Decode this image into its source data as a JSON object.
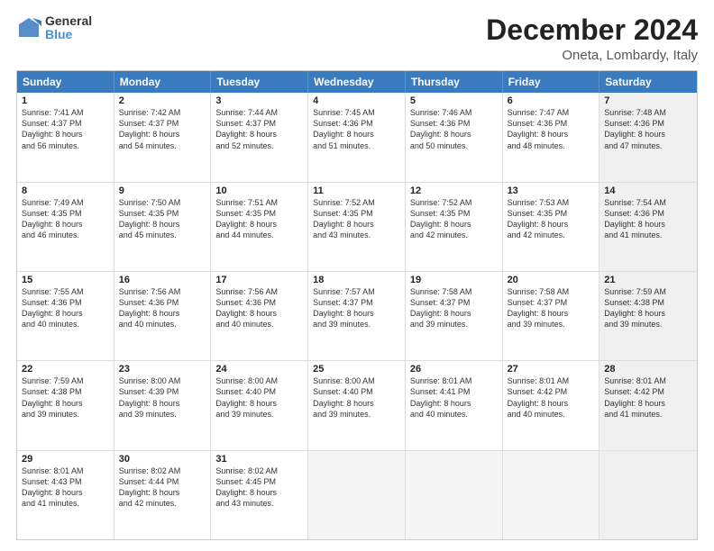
{
  "header": {
    "logo_line1": "General",
    "logo_line2": "Blue",
    "month_title": "December 2024",
    "location": "Oneta, Lombardy, Italy"
  },
  "days_of_week": [
    "Sunday",
    "Monday",
    "Tuesday",
    "Wednesday",
    "Thursday",
    "Friday",
    "Saturday"
  ],
  "weeks": [
    [
      {
        "day": "1",
        "info": "Sunrise: 7:41 AM\nSunset: 4:37 PM\nDaylight: 8 hours\nand 56 minutes.",
        "empty": false,
        "shaded": false
      },
      {
        "day": "2",
        "info": "Sunrise: 7:42 AM\nSunset: 4:37 PM\nDaylight: 8 hours\nand 54 minutes.",
        "empty": false,
        "shaded": false
      },
      {
        "day": "3",
        "info": "Sunrise: 7:44 AM\nSunset: 4:37 PM\nDaylight: 8 hours\nand 52 minutes.",
        "empty": false,
        "shaded": false
      },
      {
        "day": "4",
        "info": "Sunrise: 7:45 AM\nSunset: 4:36 PM\nDaylight: 8 hours\nand 51 minutes.",
        "empty": false,
        "shaded": false
      },
      {
        "day": "5",
        "info": "Sunrise: 7:46 AM\nSunset: 4:36 PM\nDaylight: 8 hours\nand 50 minutes.",
        "empty": false,
        "shaded": false
      },
      {
        "day": "6",
        "info": "Sunrise: 7:47 AM\nSunset: 4:36 PM\nDaylight: 8 hours\nand 48 minutes.",
        "empty": false,
        "shaded": false
      },
      {
        "day": "7",
        "info": "Sunrise: 7:48 AM\nSunset: 4:36 PM\nDaylight: 8 hours\nand 47 minutes.",
        "empty": false,
        "shaded": true
      }
    ],
    [
      {
        "day": "8",
        "info": "Sunrise: 7:49 AM\nSunset: 4:35 PM\nDaylight: 8 hours\nand 46 minutes.",
        "empty": false,
        "shaded": false
      },
      {
        "day": "9",
        "info": "Sunrise: 7:50 AM\nSunset: 4:35 PM\nDaylight: 8 hours\nand 45 minutes.",
        "empty": false,
        "shaded": false
      },
      {
        "day": "10",
        "info": "Sunrise: 7:51 AM\nSunset: 4:35 PM\nDaylight: 8 hours\nand 44 minutes.",
        "empty": false,
        "shaded": false
      },
      {
        "day": "11",
        "info": "Sunrise: 7:52 AM\nSunset: 4:35 PM\nDaylight: 8 hours\nand 43 minutes.",
        "empty": false,
        "shaded": false
      },
      {
        "day": "12",
        "info": "Sunrise: 7:52 AM\nSunset: 4:35 PM\nDaylight: 8 hours\nand 42 minutes.",
        "empty": false,
        "shaded": false
      },
      {
        "day": "13",
        "info": "Sunrise: 7:53 AM\nSunset: 4:35 PM\nDaylight: 8 hours\nand 42 minutes.",
        "empty": false,
        "shaded": false
      },
      {
        "day": "14",
        "info": "Sunrise: 7:54 AM\nSunset: 4:36 PM\nDaylight: 8 hours\nand 41 minutes.",
        "empty": false,
        "shaded": true
      }
    ],
    [
      {
        "day": "15",
        "info": "Sunrise: 7:55 AM\nSunset: 4:36 PM\nDaylight: 8 hours\nand 40 minutes.",
        "empty": false,
        "shaded": false
      },
      {
        "day": "16",
        "info": "Sunrise: 7:56 AM\nSunset: 4:36 PM\nDaylight: 8 hours\nand 40 minutes.",
        "empty": false,
        "shaded": false
      },
      {
        "day": "17",
        "info": "Sunrise: 7:56 AM\nSunset: 4:36 PM\nDaylight: 8 hours\nand 40 minutes.",
        "empty": false,
        "shaded": false
      },
      {
        "day": "18",
        "info": "Sunrise: 7:57 AM\nSunset: 4:37 PM\nDaylight: 8 hours\nand 39 minutes.",
        "empty": false,
        "shaded": false
      },
      {
        "day": "19",
        "info": "Sunrise: 7:58 AM\nSunset: 4:37 PM\nDaylight: 8 hours\nand 39 minutes.",
        "empty": false,
        "shaded": false
      },
      {
        "day": "20",
        "info": "Sunrise: 7:58 AM\nSunset: 4:37 PM\nDaylight: 8 hours\nand 39 minutes.",
        "empty": false,
        "shaded": false
      },
      {
        "day": "21",
        "info": "Sunrise: 7:59 AM\nSunset: 4:38 PM\nDaylight: 8 hours\nand 39 minutes.",
        "empty": false,
        "shaded": true
      }
    ],
    [
      {
        "day": "22",
        "info": "Sunrise: 7:59 AM\nSunset: 4:38 PM\nDaylight: 8 hours\nand 39 minutes.",
        "empty": false,
        "shaded": false
      },
      {
        "day": "23",
        "info": "Sunrise: 8:00 AM\nSunset: 4:39 PM\nDaylight: 8 hours\nand 39 minutes.",
        "empty": false,
        "shaded": false
      },
      {
        "day": "24",
        "info": "Sunrise: 8:00 AM\nSunset: 4:40 PM\nDaylight: 8 hours\nand 39 minutes.",
        "empty": false,
        "shaded": false
      },
      {
        "day": "25",
        "info": "Sunrise: 8:00 AM\nSunset: 4:40 PM\nDaylight: 8 hours\nand 39 minutes.",
        "empty": false,
        "shaded": false
      },
      {
        "day": "26",
        "info": "Sunrise: 8:01 AM\nSunset: 4:41 PM\nDaylight: 8 hours\nand 40 minutes.",
        "empty": false,
        "shaded": false
      },
      {
        "day": "27",
        "info": "Sunrise: 8:01 AM\nSunset: 4:42 PM\nDaylight: 8 hours\nand 40 minutes.",
        "empty": false,
        "shaded": false
      },
      {
        "day": "28",
        "info": "Sunrise: 8:01 AM\nSunset: 4:42 PM\nDaylight: 8 hours\nand 41 minutes.",
        "empty": false,
        "shaded": true
      }
    ],
    [
      {
        "day": "29",
        "info": "Sunrise: 8:01 AM\nSunset: 4:43 PM\nDaylight: 8 hours\nand 41 minutes.",
        "empty": false,
        "shaded": false
      },
      {
        "day": "30",
        "info": "Sunrise: 8:02 AM\nSunset: 4:44 PM\nDaylight: 8 hours\nand 42 minutes.",
        "empty": false,
        "shaded": false
      },
      {
        "day": "31",
        "info": "Sunrise: 8:02 AM\nSunset: 4:45 PM\nDaylight: 8 hours\nand 43 minutes.",
        "empty": false,
        "shaded": false
      },
      {
        "day": "",
        "info": "",
        "empty": true,
        "shaded": false
      },
      {
        "day": "",
        "info": "",
        "empty": true,
        "shaded": false
      },
      {
        "day": "",
        "info": "",
        "empty": true,
        "shaded": false
      },
      {
        "day": "",
        "info": "",
        "empty": true,
        "shaded": true
      }
    ]
  ]
}
